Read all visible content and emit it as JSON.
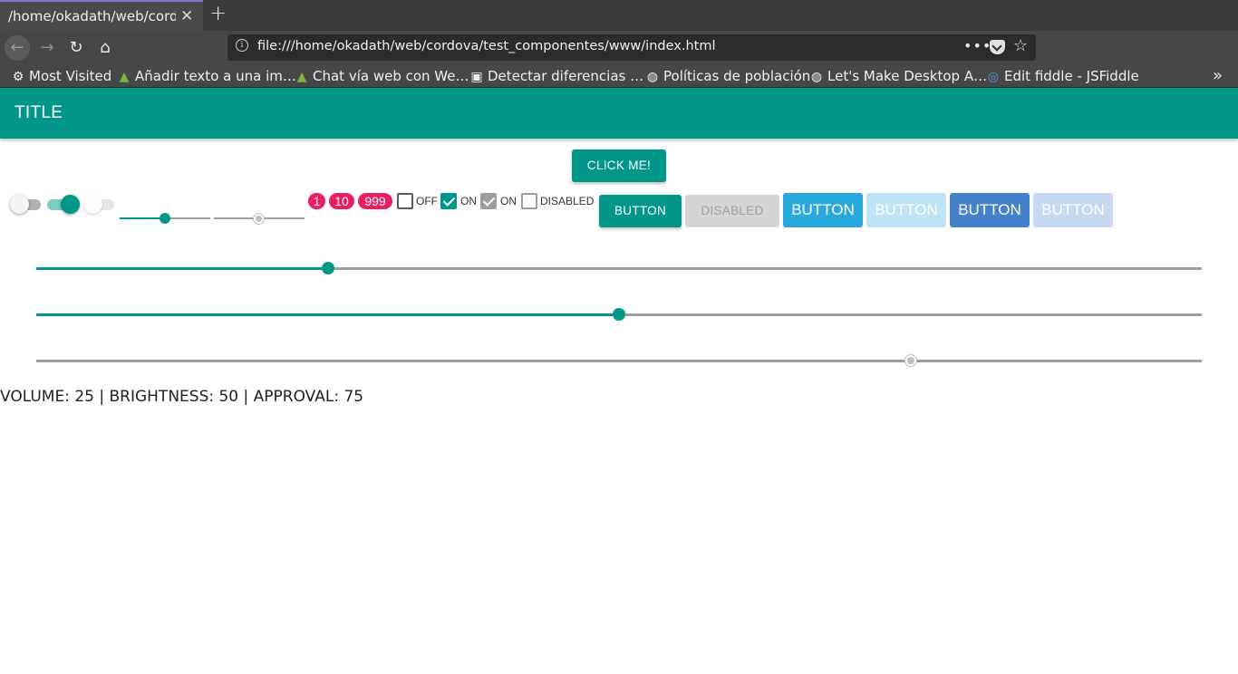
{
  "browser": {
    "tab_title": "/home/okadath/web/cordova/test_componentes/www/index.html",
    "tab_close_glyph": "✕",
    "new_tab_glyph": "+",
    "url": "file:///home/okadath/web/cordova/test_componentes/www/index.html",
    "icons": {
      "back": "←",
      "forward": "→",
      "reload": "↻",
      "home": "⌂",
      "info": "i",
      "more": "•••",
      "star": "☆",
      "library": "|||\\",
      "menu": "≡",
      "overflow": "»"
    }
  },
  "bookmarks": [
    {
      "icon": "⚙",
      "label": "Most Visited"
    },
    {
      "icon": "🦎",
      "label": "Añadir texto a una im…"
    },
    {
      "icon": "🦎",
      "label": "Chat vía web con We…"
    },
    {
      "icon": "▣",
      "label": "Detectar diferencias …"
    },
    {
      "icon": "🌐",
      "label": "Políticas de población"
    },
    {
      "icon": "🌐",
      "label": "Let's Make Desktop A…"
    },
    {
      "icon": "◎",
      "label": "Edit fiddle - JSFiddle"
    }
  ],
  "app": {
    "title": "TITLE",
    "click_button": "CLICK ME!",
    "accent_color": "#009688",
    "switches": [
      {
        "state": "off",
        "enabled": true
      },
      {
        "state": "on",
        "enabled": true
      },
      {
        "state": "off",
        "enabled": false
      }
    ],
    "mini_sliders": [
      {
        "value": 50,
        "enabled": true
      },
      {
        "value": 50,
        "enabled": false
      }
    ],
    "badges": [
      "1",
      "10",
      "999"
    ],
    "badge_color": "#e91e63",
    "checkboxes": [
      {
        "label": "OFF",
        "checked": false,
        "enabled": true
      },
      {
        "label": "ON",
        "checked": true,
        "enabled": true
      },
      {
        "label": "ON",
        "checked": true,
        "enabled": false
      },
      {
        "label": "DISABLED",
        "checked": false,
        "enabled": false
      }
    ],
    "buttons": [
      {
        "label": "BUTTON",
        "style": "teal",
        "enabled": true
      },
      {
        "label": "DISABLED",
        "style": "gray",
        "enabled": false
      },
      {
        "label": "BUTTON",
        "style": "blue",
        "enabled": true
      },
      {
        "label": "BUTTON",
        "style": "blue",
        "enabled": false
      },
      {
        "label": "BUTTON",
        "style": "dark-blue",
        "enabled": true
      },
      {
        "label": "BUTTON",
        "style": "dark-blue",
        "enabled": false
      }
    ],
    "sliders": [
      {
        "name": "volume",
        "value": 25,
        "enabled": true
      },
      {
        "name": "brightness",
        "value": 50,
        "enabled": true
      },
      {
        "name": "approval",
        "value": 75,
        "enabled": false
      }
    ],
    "status_text": "VOLUME: 25 | BRIGHTNESS: 50 | APPROVAL: 75"
  }
}
